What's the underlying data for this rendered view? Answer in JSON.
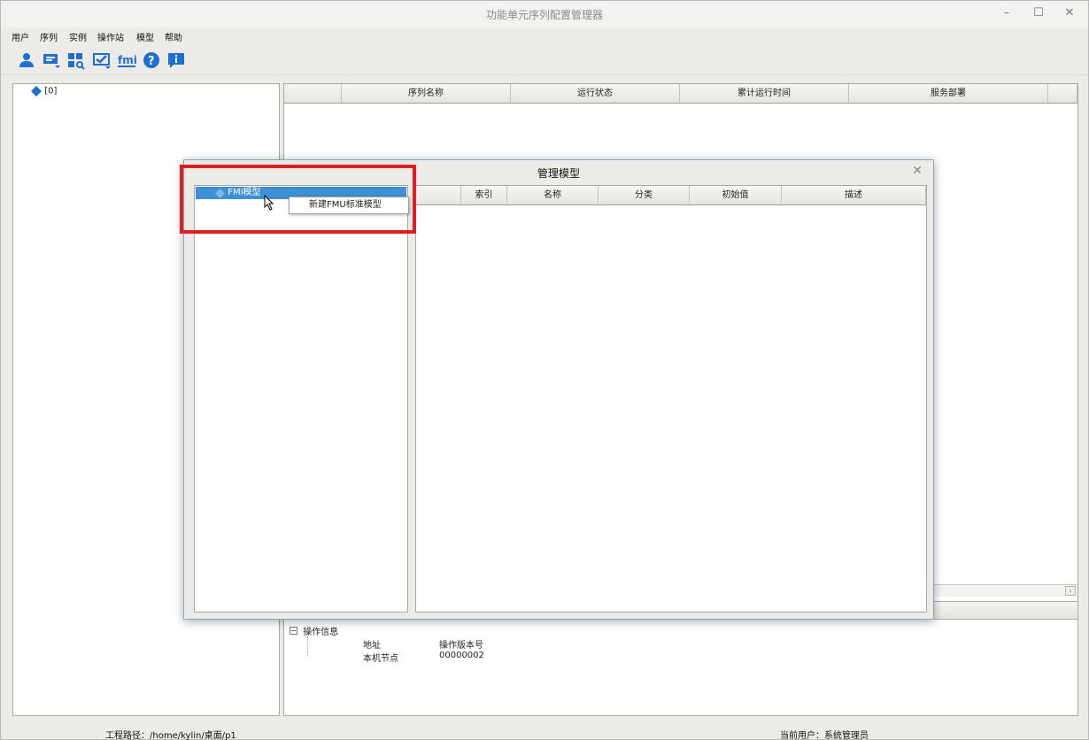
{
  "window": {
    "title": "功能单元序列配置管理器"
  },
  "menu": [
    "用户",
    "序列",
    "实例",
    "操作站",
    "模型",
    "帮助"
  ],
  "toolbar": [
    "user-icon",
    "sequence-icon",
    "instance-icon",
    "station-icon",
    "fmi-icon",
    "help-icon",
    "info-icon"
  ],
  "toolbar_fmi_label": "fmi",
  "tree": {
    "root": "[0]"
  },
  "main_table": {
    "columns": [
      "",
      "序列名称",
      "运行状态",
      "累计运行时间",
      "服务部署"
    ]
  },
  "info": {
    "section": "操作信息",
    "rows": [
      {
        "key": "地址",
        "value": "操作版本号"
      },
      {
        "key": "本机节点",
        "value": "00000002"
      }
    ]
  },
  "status": {
    "project_path": "工程路径：/home/kylin/桌面/p1",
    "current_user": "当前用户：系统管理员"
  },
  "dialog": {
    "title": "管理模型",
    "tree_item": "FMI模型",
    "context_menu_item": "新建FMU标准模型",
    "columns": [
      "",
      "索引",
      "名称",
      "分类",
      "初始值",
      "描述"
    ]
  },
  "colors": {
    "highlight": "#e01e1e",
    "selection": "#3e8fd4",
    "icon": "#1f6fd1"
  }
}
